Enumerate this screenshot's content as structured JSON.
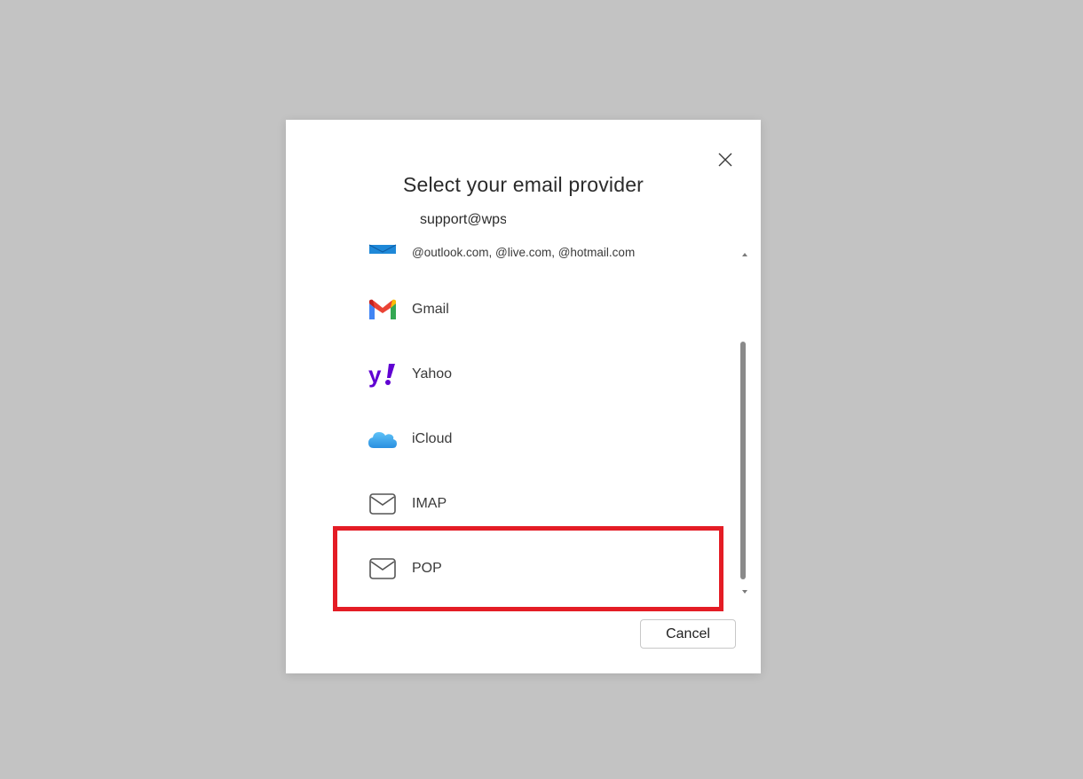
{
  "dialog": {
    "title": "Select your email provider",
    "email": "support@wps",
    "cancel_label": "Cancel"
  },
  "providers": [
    {
      "label": "@outlook.com, @live.com, @hotmail.com",
      "icon": "outlook-icon"
    },
    {
      "label": "Gmail",
      "icon": "gmail-icon"
    },
    {
      "label": "Yahoo",
      "icon": "yahoo-icon"
    },
    {
      "label": "iCloud",
      "icon": "icloud-icon"
    },
    {
      "label": "IMAP",
      "icon": "mail-envelope-icon"
    },
    {
      "label": "POP",
      "icon": "mail-envelope-icon"
    }
  ],
  "colors": {
    "highlight": "#e41c25",
    "backdrop": "#c3c3c3",
    "yahoo": "#6001d2"
  }
}
